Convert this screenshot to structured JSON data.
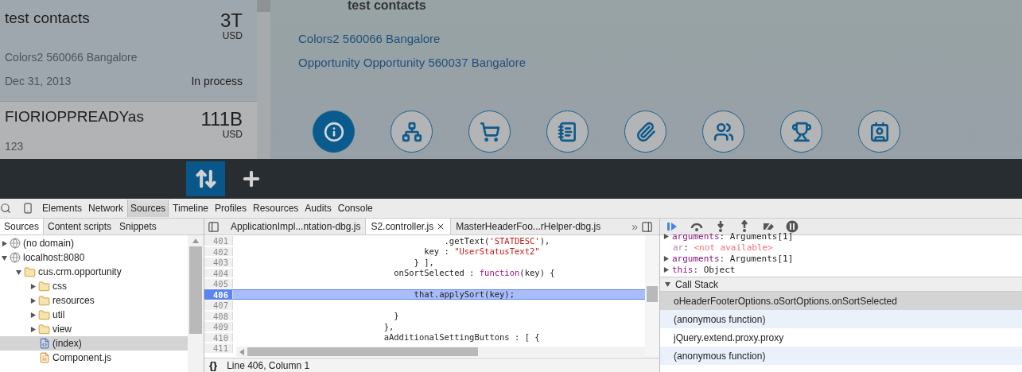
{
  "master_list": {
    "items": [
      {
        "title": "test contacts",
        "amount": "3T",
        "currency": "USD",
        "subtitle": "Colors2 560066 Bangalore",
        "date": "Dec 31, 2013",
        "status": "In process",
        "selected": true
      },
      {
        "title": "FIORIOPPREADYas",
        "amount": "111B",
        "currency": "USD",
        "subtitle": "123",
        "selected": false
      }
    ]
  },
  "detail": {
    "title": "test contacts",
    "lines": [
      "Colors2 560066 Bangalore",
      "Opportunity Opportunity 560037 Bangalore"
    ],
    "icon_tabs": [
      {
        "kind": "info",
        "selected": true
      },
      {
        "kind": "hierarchy",
        "selected": false
      },
      {
        "kind": "cart",
        "selected": false
      },
      {
        "kind": "notes",
        "selected": false
      },
      {
        "kind": "attachment",
        "selected": false
      },
      {
        "kind": "people",
        "selected": false
      },
      {
        "kind": "trophy",
        "selected": false
      },
      {
        "kind": "contact",
        "selected": false
      }
    ]
  },
  "footer_buttons": [
    {
      "kind": "sort",
      "selected": true
    },
    {
      "kind": "add",
      "selected": false
    }
  ],
  "devtools": {
    "tabs": [
      {
        "label": "Elements",
        "selected": false
      },
      {
        "label": "Network",
        "selected": false
      },
      {
        "label": "Sources",
        "selected": true
      },
      {
        "label": "Timeline",
        "selected": false
      },
      {
        "label": "Profiles",
        "selected": false
      },
      {
        "label": "Resources",
        "selected": false
      },
      {
        "label": "Audits",
        "selected": false
      },
      {
        "label": "Console",
        "selected": false
      }
    ],
    "navigator": {
      "tabs": [
        {
          "label": "Sources",
          "selected": true
        },
        {
          "label": "Content scripts",
          "selected": false
        },
        {
          "label": "Snippets",
          "selected": false
        }
      ],
      "tree": [
        {
          "label": "(no domain)",
          "kind": "domain",
          "expanded": false,
          "selected": false
        },
        {
          "label": "localhost:8080",
          "kind": "domain",
          "expanded": true,
          "selected": false,
          "children": [
            {
              "label": "cus.crm.opportunity",
              "kind": "folder",
              "expanded": true,
              "selected": false,
              "children": [
                {
                  "label": "css",
                  "kind": "folder",
                  "expanded": false,
                  "selected": false
                },
                {
                  "label": "resources",
                  "kind": "folder",
                  "expanded": false,
                  "selected": false
                },
                {
                  "label": "util",
                  "kind": "folder",
                  "expanded": false,
                  "selected": false
                },
                {
                  "label": "view",
                  "kind": "folder",
                  "expanded": false,
                  "selected": false
                },
                {
                  "label": "(index)",
                  "kind": "page",
                  "selected": true
                },
                {
                  "label": "Component.js",
                  "kind": "script",
                  "selected": false
                }
              ]
            }
          ]
        }
      ]
    },
    "editor": {
      "tabs": [
        {
          "label": "ApplicationImpl...ntation-dbg.js",
          "selected": false,
          "closable": false
        },
        {
          "label": "S2.controller.js",
          "selected": true,
          "closable": true
        },
        {
          "label": "MasterHeaderFoo...rHelper-dbg.js",
          "selected": false,
          "closable": false
        }
      ],
      "overflow": "»",
      "lines": [
        {
          "number": "401",
          "current": false,
          "segments": [
            {
              "text": "                                          .getText(",
              "kind": "plain"
            },
            {
              "text": "'STATDESC'",
              "kind": "string"
            },
            {
              "text": "),",
              "kind": "plain"
            }
          ]
        },
        {
          "number": "402",
          "current": false,
          "segments": [
            {
              "text": "                                      key : ",
              "kind": "plain"
            },
            {
              "text": "\"UserStatusText2\"",
              "kind": "string"
            }
          ]
        },
        {
          "number": "403",
          "current": false,
          "segments": [
            {
              "text": "                                    } ],",
              "kind": "plain"
            }
          ]
        },
        {
          "number": "404",
          "current": false,
          "segments": [
            {
              "text": "                                onSortSelected : ",
              "kind": "plain"
            },
            {
              "text": "function",
              "kind": "keyword"
            },
            {
              "text": "(key) {",
              "kind": "plain"
            }
          ]
        },
        {
          "number": "405",
          "current": false
        },
        {
          "number": "406",
          "current": true,
          "segments": [
            {
              "text": "                                    that.applySort(key);",
              "kind": "plain"
            }
          ]
        },
        {
          "number": "407",
          "current": false
        },
        {
          "number": "408",
          "current": false,
          "segments": [
            {
              "text": "                                }",
              "kind": "plain"
            }
          ]
        },
        {
          "number": "409",
          "current": false,
          "segments": [
            {
              "text": "                              },",
              "kind": "plain"
            }
          ]
        },
        {
          "number": "410",
          "current": false,
          "segments": [
            {
              "text": "                              aAdditionalSettingButtons : [ {",
              "kind": "plain"
            }
          ]
        },
        {
          "number": "411",
          "current": false
        }
      ],
      "pretty_print": "{}",
      "status": "Line 406, Column 1"
    },
    "debugger": {
      "controls": [
        {
          "kind": "resume",
          "on": true
        },
        {
          "kind": "step-over",
          "on": false
        },
        {
          "kind": "step-into",
          "on": false
        },
        {
          "kind": "step-out",
          "on": false
        },
        {
          "kind": "deactivate",
          "on": false
        },
        {
          "kind": "pause",
          "on": false
        }
      ],
      "scope": [
        {
          "name": "arguments",
          "separator": ":",
          "value": "Arguments[1]",
          "expandable": true,
          "unavailable": false
        },
        {
          "name": "ar",
          "separator": ":",
          "value": "<not available>",
          "expandable": false,
          "unavailable": true
        },
        {
          "name": "arguments",
          "separator": ":",
          "value": "Arguments[1]",
          "expandable": true,
          "unavailable": false
        },
        {
          "name": "this",
          "separator": ":",
          "value": "Object",
          "expandable": true,
          "unavailable": false
        }
      ],
      "call_stack": {
        "title": "Call Stack",
        "expanded": true,
        "items": [
          {
            "label": "oHeaderFooterOptions.oSortOptions.onSortSelected",
            "selected": true
          },
          {
            "label": "(anonymous function)",
            "selected": false
          },
          {
            "label": "jQuery.extend.proxy.proxy",
            "selected": false
          },
          {
            "label": "(anonymous function)",
            "selected": false
          }
        ]
      }
    }
  }
}
